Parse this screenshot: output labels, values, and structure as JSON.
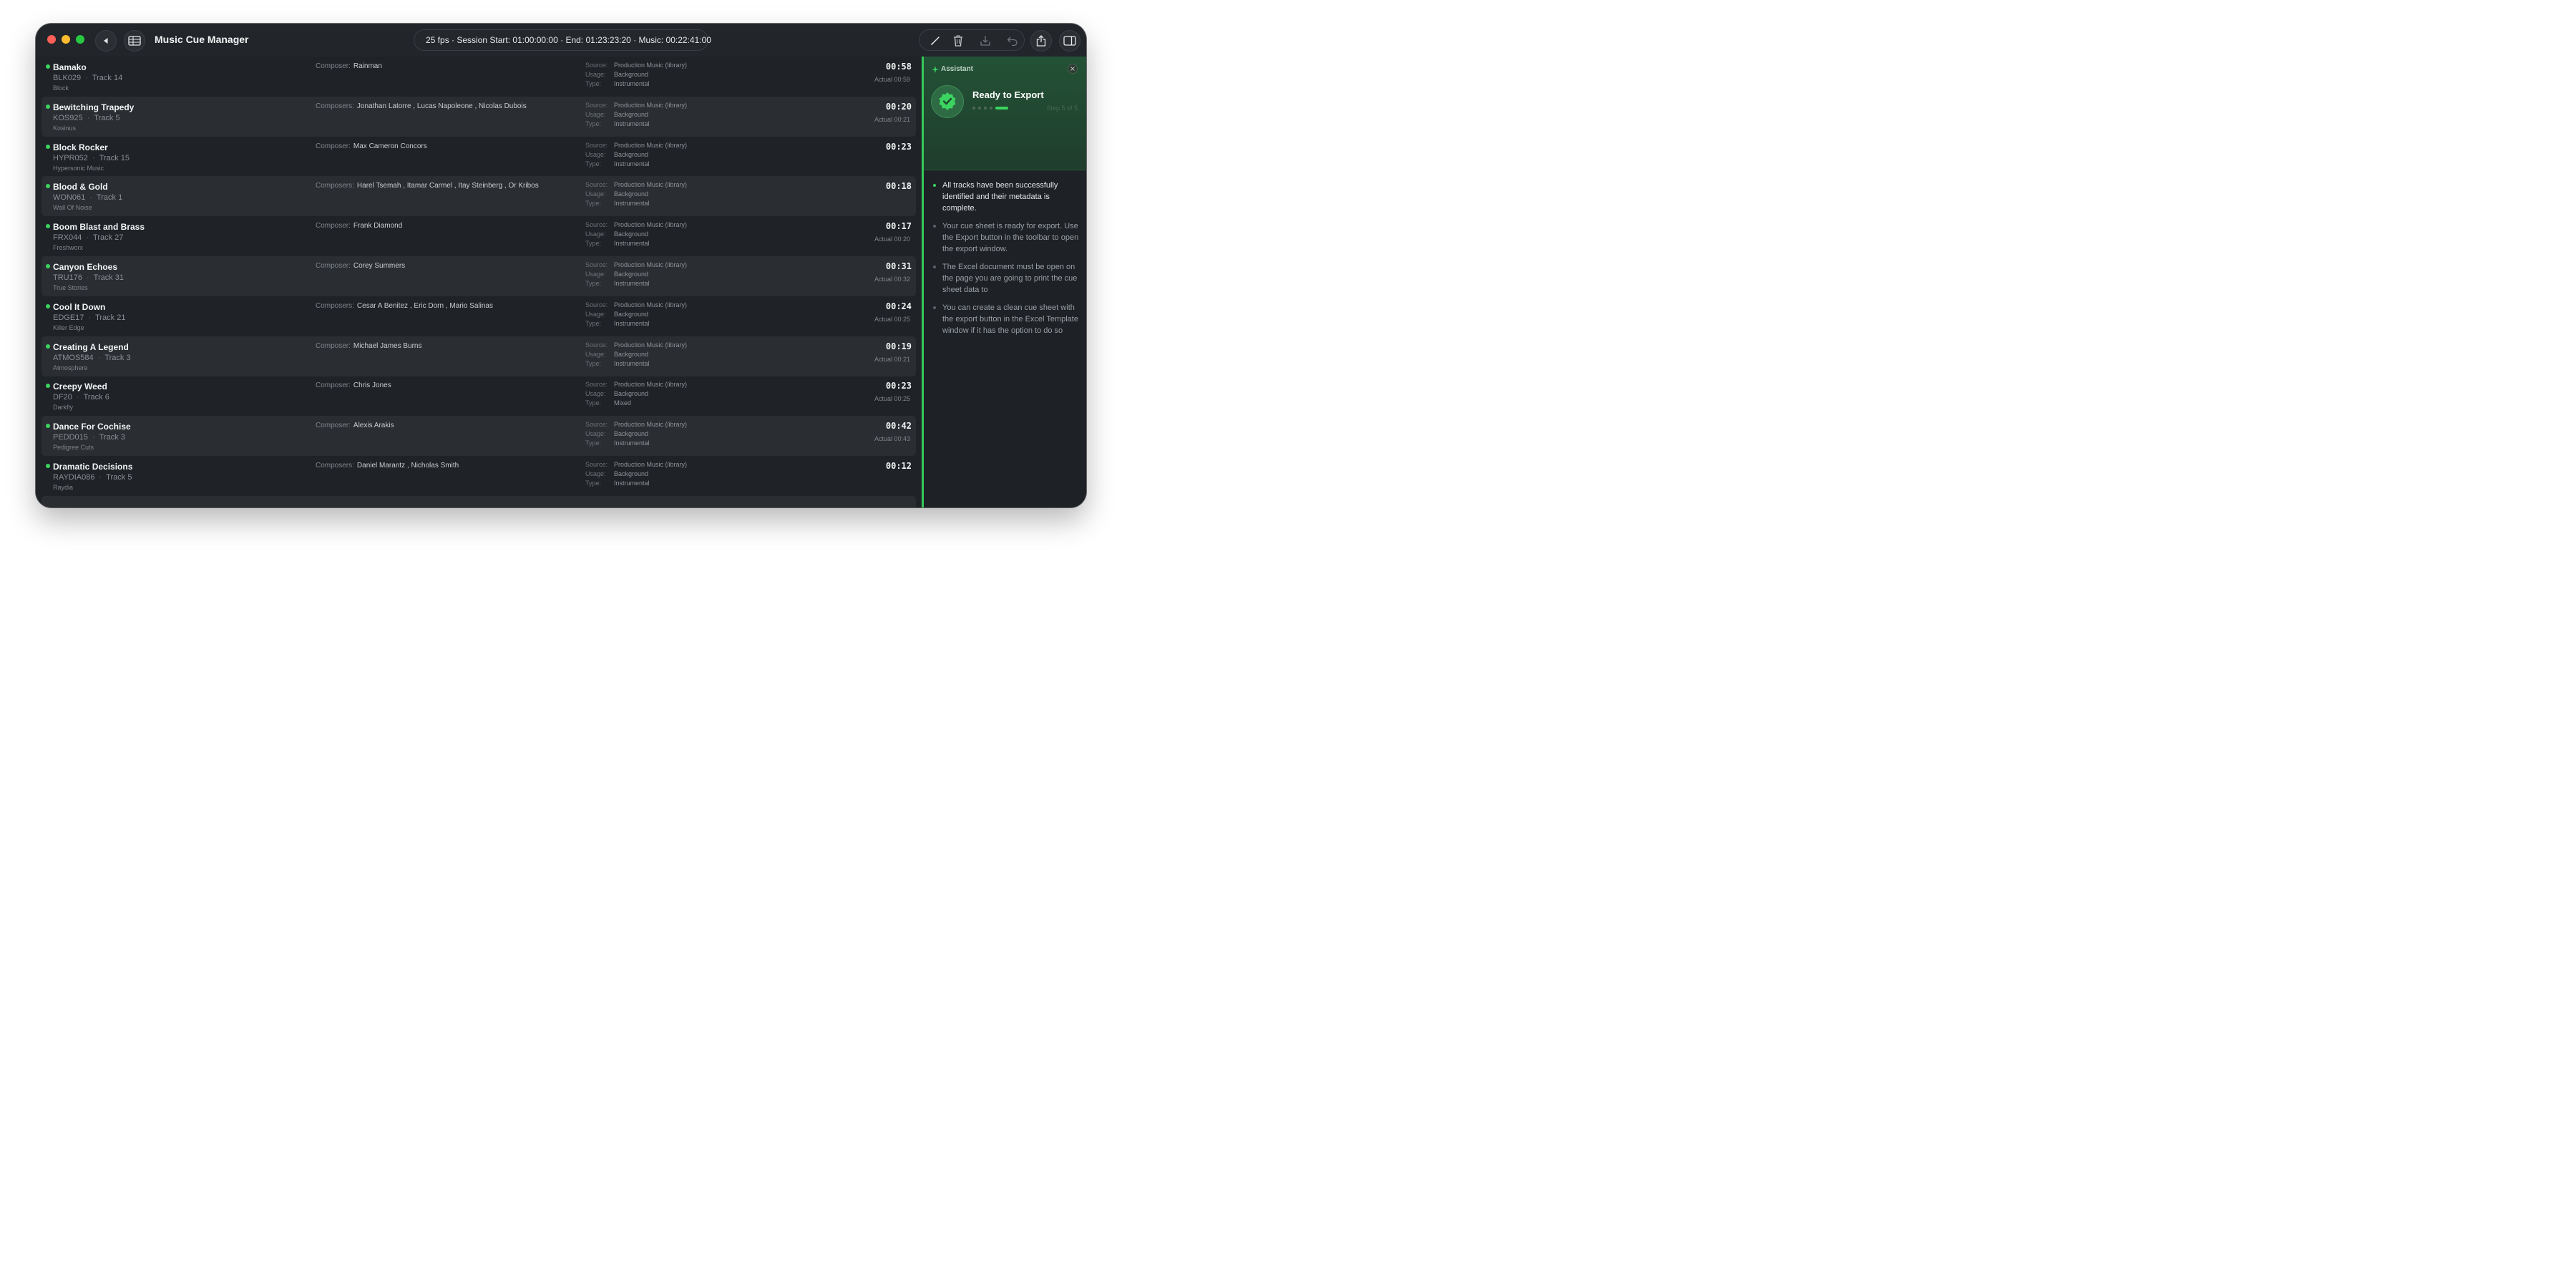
{
  "app": {
    "title": "Music Cue Manager"
  },
  "session": {
    "summary": "25 fps · Session Start: 01:00:00:00 · End: 01:23:23:20 · Music: 00:22:41:00"
  },
  "labels": {
    "composer": "Composer:",
    "composers": "Composers:",
    "source": "Source:",
    "usage": "Usage:",
    "type": "Type:"
  },
  "tracks": [
    {
      "title": "Bamako",
      "code": "BLK029",
      "track": "Track 14",
      "label": "Block",
      "composer_label": "Composer:",
      "composers": "Rainman",
      "source": "Production Music (library)",
      "usage": "Background",
      "type": "Instrumental",
      "duration": "00:58",
      "actual": "Actual 00:59"
    },
    {
      "title": "Bewitching Trapedy",
      "code": "KOS925",
      "track": "Track 5",
      "label": "Kosinus",
      "composer_label": "Composers:",
      "composers": "Jonathan Latorre , Lucas Napoleone , Nicolas Dubois",
      "source": "Production Music (library)",
      "usage": "Background",
      "type": "Instrumental",
      "duration": "00:20",
      "actual": "Actual 00:21"
    },
    {
      "title": "Block Rocker",
      "code": "HYPR052",
      "track": "Track 15",
      "label": "Hypersonic Music",
      "composer_label": "Composer:",
      "composers": "Max Cameron Concors",
      "source": "Production Music (library)",
      "usage": "Background",
      "type": "Instrumental",
      "duration": "00:23",
      "actual": ""
    },
    {
      "title": "Blood & Gold",
      "code": "WON061",
      "track": "Track 1",
      "label": "Wall Of Noise",
      "composer_label": "Composers:",
      "composers": "Harel Tsemah , Itamar Carmel , Itay Steinberg , Or Kribos",
      "source": "Production Music (library)",
      "usage": "Background",
      "type": "Instrumental",
      "duration": "00:18",
      "actual": ""
    },
    {
      "title": "Boom Blast and Brass",
      "code": "FRX044",
      "track": "Track 27",
      "label": "Freshworx",
      "composer_label": "Composer:",
      "composers": "Frank Diamond",
      "source": "Production Music (library)",
      "usage": "Background",
      "type": "Instrumental",
      "duration": "00:17",
      "actual": "Actual 00:20"
    },
    {
      "title": "Canyon Echoes",
      "code": "TRU176",
      "track": "Track 31",
      "label": "True Stories",
      "composer_label": "Composer:",
      "composers": "Corey Summers",
      "source": "Production Music (library)",
      "usage": "Background",
      "type": "Instrumental",
      "duration": "00:31",
      "actual": "Actual 00:32"
    },
    {
      "title": "Cool It Down",
      "code": "EDGE17",
      "track": "Track 21",
      "label": "Killer Edge",
      "composer_label": "Composers:",
      "composers": "Cesar A Benitez , Eric Dorn , Mario Salinas",
      "source": "Production Music (library)",
      "usage": "Background",
      "type": "Instrumental",
      "duration": "00:24",
      "actual": "Actual 00:25"
    },
    {
      "title": "Creating A Legend",
      "code": "ATMOS584",
      "track": "Track 3",
      "label": "Atmosphere",
      "composer_label": "Composer:",
      "composers": "Michael James Burns",
      "source": "Production Music (library)",
      "usage": "Background",
      "type": "Instrumental",
      "duration": "00:19",
      "actual": "Actual 00:21"
    },
    {
      "title": "Creepy Weed",
      "code": "DF20",
      "track": "Track 6",
      "label": "Darkfly",
      "composer_label": "Composer:",
      "composers": "Chris Jones",
      "source": "Production Music (library)",
      "usage": "Background",
      "type": "Mixed",
      "duration": "00:23",
      "actual": "Actual 00:25"
    },
    {
      "title": "Dance For Cochise",
      "code": "PEDD015",
      "track": "Track 3",
      "label": "Pedigree Cuts",
      "composer_label": "Composer:",
      "composers": "Alexis Arakis",
      "source": "Production Music (library)",
      "usage": "Background",
      "type": "Instrumental",
      "duration": "00:42",
      "actual": "Actual 00:43"
    },
    {
      "title": "Dramatic Decisions",
      "code": "RAYDIA086",
      "track": "Track 5",
      "label": "Raydia",
      "composer_label": "Composers:",
      "composers": "Daniel Marantz , Nicholas Smith",
      "source": "Production Music (library)",
      "usage": "Background",
      "type": "Instrumental",
      "duration": "00:12",
      "actual": ""
    }
  ],
  "assistant": {
    "label": "Assistant",
    "title": "Ready to Export",
    "step": "Step 5 of 5",
    "progress": {
      "current": 5,
      "total": 5
    },
    "bullets": [
      "All tracks have been successfully identified and their metadata is complete.",
      "Your cue sheet is ready for export. Use the Export button in the toolbar to open the export window.",
      "The Excel document must be open on the page you are going to print the cue sheet data to",
      "You can create a clean cue sheet with the export button in the Excel Template window if it has the option to do so"
    ]
  },
  "colors": {
    "accent": "#3cd460",
    "window_bg": "#1f2226",
    "panel_green": "#235236"
  }
}
